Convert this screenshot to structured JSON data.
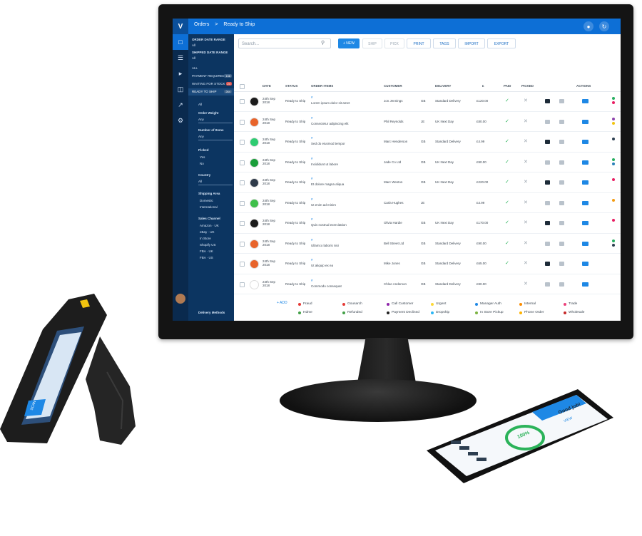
{
  "app": {
    "logo": "V",
    "breadcrumb": [
      "Orders",
      ">",
      "Ready to Ship"
    ]
  },
  "topbar": {
    "bell_icon": "bell-icon",
    "sync_icon": "sync-icon"
  },
  "rail": {
    "icons": [
      "orders-icon",
      "list-icon",
      "tag-icon",
      "cart-icon",
      "chart-icon",
      "settings-icon"
    ]
  },
  "filters": {
    "order_date_range": "ORDER DATE RANGE",
    "order_date_value": "All",
    "shipped_date_range": "SHIPPED DATE RANGE",
    "shipped_date_value": "All",
    "all": "ALL",
    "status_items": [
      {
        "label": "PAYMENT REQUIRED",
        "count": "138"
      },
      {
        "label": "WAITING FOR STOCK",
        "count": "24"
      },
      {
        "label": "READY TO SHIP",
        "count": "264"
      }
    ],
    "all2": "All",
    "order_weight": "Order Weight",
    "any1": "Any",
    "number_of_items": "Number of Items",
    "any2": "Any",
    "picked": "Picked",
    "yes": "Yes",
    "no": "No",
    "country": "Country",
    "all3": "All",
    "shipping_area": "Shipping Area",
    "domestic": "Domestic",
    "international": "International",
    "sales_channel": "Sales Channel",
    "amazon_uk": "Amazon · UK",
    "ebay_uk": "eBay · UK",
    "instore": "In Store",
    "shopify": "Shopify US",
    "fba_uk": "FBA · UK",
    "fba_us": "FBA · US",
    "delivery_methods": "Delivery Methods"
  },
  "toolbar": {
    "search_placeholder": "Search...",
    "new": "+ NEW",
    "ship": "SHIP",
    "pick": "PICK",
    "print": "PRINT",
    "tags": "TAGS",
    "import": "IMPORT",
    "export": "EXPORT"
  },
  "table": {
    "headers": [
      "DATE",
      "STATUS",
      "ORDER ITEMS",
      "CUSTOMER",
      "DELIVERY",
      "£",
      "PAID",
      "PICKED",
      "ACTIONS"
    ],
    "rows": [
      {
        "date": "24th Sep 2018",
        "status": "Ready to Ship",
        "item": "Lorem ipsum dolor sit amet",
        "customer": "Jon Jennings",
        "country": "GB",
        "delivery": "Standard Delivery",
        "price": "£120.00",
        "paid": true,
        "picked": false,
        "avatar": "#1b1b1b",
        "dots": [
          "#27ae60",
          "#e91e63"
        ]
      },
      {
        "date": "24th Sep 2018",
        "status": "Ready to Ship",
        "item": "Consectetur adipiscing elit",
        "customer": "Phil Reynolds",
        "country": "JE",
        "delivery": "UK Next Day",
        "price": "£80.00",
        "paid": true,
        "picked": false,
        "avatar": "#e8642b",
        "dots": [
          "#8e44ad",
          "#f1c40f"
        ]
      },
      {
        "date": "24th Sep 2018",
        "status": "Ready to Ship",
        "item": "Sed do eiusmod tempor",
        "customer": "Marc Henderson",
        "country": "GB",
        "delivery": "Standard Delivery",
        "price": "£4.99",
        "paid": true,
        "picked": false,
        "avatar": "#2ecc71",
        "dots": [
          "#2c3e50"
        ]
      },
      {
        "date": "24th Sep 2018",
        "status": "Ready to Ship",
        "item": "Incididunt ut labore",
        "customer": "Jade Co Ltd",
        "country": "GB",
        "delivery": "UK Next Day",
        "price": "£90.00",
        "paid": true,
        "picked": false,
        "avatar": "#1a9e3a",
        "dots": [
          "#27ae60",
          "#2980b9"
        ]
      },
      {
        "date": "24th Sep 2018",
        "status": "Ready to Ship",
        "item": "Et dolore magna aliqua",
        "customer": "Marc Weston",
        "country": "GB",
        "delivery": "UK Next Day",
        "price": "£220.00",
        "paid": true,
        "picked": false,
        "avatar": "#2f3b4a",
        "dots": [
          "#e91e63"
        ]
      },
      {
        "date": "24th Sep 2018",
        "status": "Ready to Ship",
        "item": "Ut enim ad minim",
        "customer": "Carla Hughes",
        "country": "JE",
        "delivery": "",
        "price": "£4.99",
        "paid": true,
        "picked": false,
        "avatar": "#3fbf4a",
        "dots": [
          "#f39c12"
        ]
      },
      {
        "date": "24th Sep 2018",
        "status": "Ready to Ship",
        "item": "Quis nostrud exercitation",
        "customer": "Olivia Hardie",
        "country": "GB",
        "delivery": "UK Next Day",
        "price": "£170.00",
        "paid": true,
        "picked": false,
        "avatar": "#1b1b1b",
        "dots": [
          "#e91e63"
        ]
      },
      {
        "date": "24th Sep 2018",
        "status": "Ready to Ship",
        "item": "Ullamco laboris nisi",
        "customer": "Bell Street Ltd",
        "country": "GB",
        "delivery": "Standard Delivery",
        "price": "£90.00",
        "paid": true,
        "picked": false,
        "avatar": "#e8642b",
        "dots": [
          "#27ae60",
          "#2c3e50"
        ]
      },
      {
        "date": "24th Sep 2018",
        "status": "Ready to Ship",
        "item": "Ut aliquip ex ea",
        "customer": "Mike Jones",
        "country": "GB",
        "delivery": "Standard Delivery",
        "price": "£65.00",
        "paid": true,
        "picked": false,
        "avatar": "#e8642b",
        "dots": []
      },
      {
        "date": "24th Sep 2018",
        "status": "Ready to Ship",
        "item": "Commodo consequat",
        "customer": "Chloe Anderson",
        "country": "GB",
        "delivery": "Standard Delivery",
        "price": "£90.00",
        "paid": false,
        "picked": false,
        "avatar": "#ffffff",
        "dots": []
      }
    ]
  },
  "legend": {
    "add": "+ ADD",
    "items": [
      {
        "label": "Fraud",
        "color": "#e53935"
      },
      {
        "label": "Gousarch",
        "color": "#e53935"
      },
      {
        "label": "Call Customer",
        "color": "#8e24aa"
      },
      {
        "label": "Urgent",
        "color": "#fdd835"
      },
      {
        "label": "Manager Auth",
        "color": "#1e88e5"
      },
      {
        "label": "Internal",
        "color": "#fb8c00"
      },
      {
        "label": "Trade",
        "color": "#ec407a"
      },
      {
        "label": "Hdme",
        "color": "#43a047"
      },
      {
        "label": "Refunded",
        "color": "#43a047"
      },
      {
        "label": "Payment Declined",
        "color": "#212121"
      },
      {
        "label": "Dropship",
        "color": "#29b6f6"
      },
      {
        "label": "In Store Pickup",
        "color": "#7cb342"
      },
      {
        "label": "Phone Order",
        "color": "#ffb300"
      },
      {
        "label": "Wholesale",
        "color": "#c62828"
      }
    ]
  },
  "phone": {
    "title": "Good job!",
    "progress": "100%",
    "progress_fraction": 1.0,
    "link": "VIEW"
  },
  "scanner": {
    "screen_label": "SCAN"
  },
  "colors": {
    "brand": "#0d6fd6",
    "sidebar": "#0c3561",
    "rail": "#0a2a4e",
    "success": "#2bb35a"
  }
}
